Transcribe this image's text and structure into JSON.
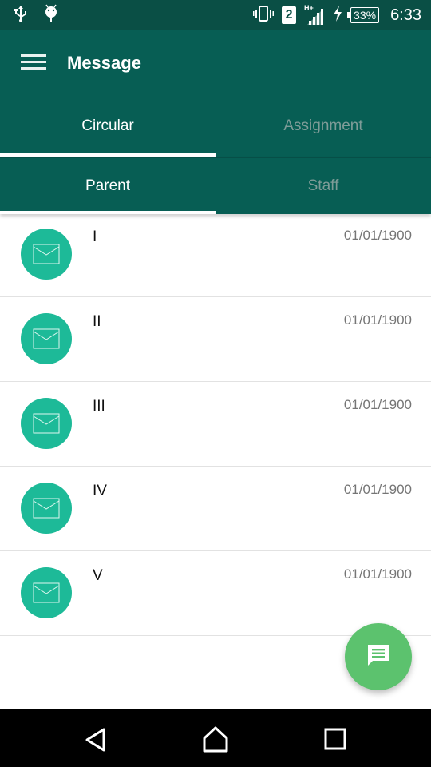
{
  "status_bar": {
    "left_icons": [
      "usb-icon",
      "android-debug-icon"
    ],
    "right_icons": [
      "vibrate-icon",
      "sim2-icon",
      "signal-icon",
      "charging-icon",
      "battery-icon"
    ],
    "sim_number": "2",
    "network_type": "H+",
    "battery_percent": "33%",
    "time": "6:33"
  },
  "toolbar": {
    "menu_icon": "hamburger-menu-icon",
    "title": "Message"
  },
  "tabs": [
    {
      "label": "Circular",
      "active": true
    },
    {
      "label": "Assignment",
      "active": false
    }
  ],
  "sub_tabs": [
    {
      "label": "Parent",
      "active": true
    },
    {
      "label": "Staff",
      "active": false
    }
  ],
  "messages": [
    {
      "title": "I",
      "date": "01/01/1900",
      "icon": "envelope-icon"
    },
    {
      "title": "II",
      "date": "01/01/1900",
      "icon": "envelope-icon"
    },
    {
      "title": "III",
      "date": "01/01/1900",
      "icon": "envelope-icon"
    },
    {
      "title": "IV",
      "date": "01/01/1900",
      "icon": "envelope-icon"
    },
    {
      "title": "V",
      "date": "01/01/1900",
      "icon": "envelope-icon"
    }
  ],
  "fab": {
    "icon": "chat-message-icon"
  },
  "nav_bar": {
    "buttons": [
      "back",
      "home",
      "recents"
    ]
  },
  "colors": {
    "primary": "#075e54",
    "status_bar": "#0a4f45",
    "avatar": "#1dba98",
    "fab": "#5cc26e"
  }
}
